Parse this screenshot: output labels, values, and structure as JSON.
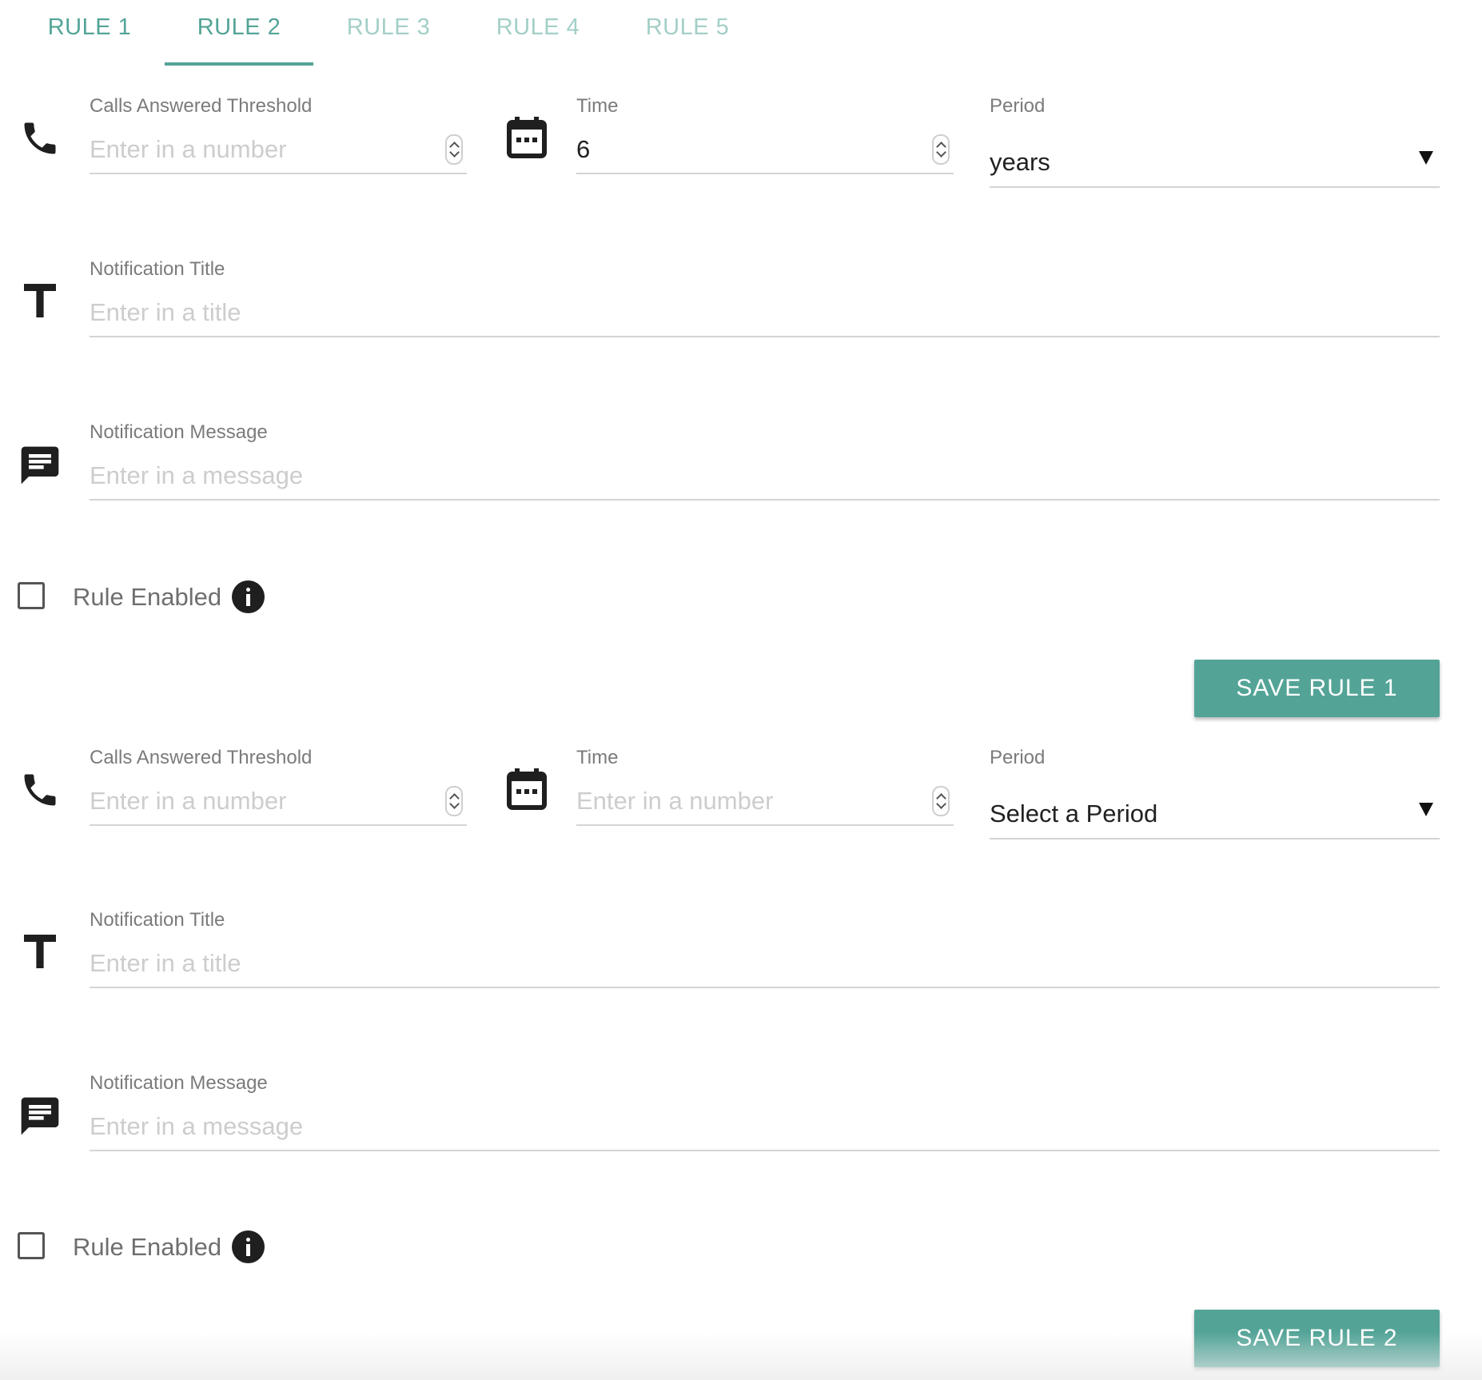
{
  "tabs": [
    {
      "label": "RULE 1"
    },
    {
      "label": "RULE 2"
    },
    {
      "label": "RULE 3"
    },
    {
      "label": "RULE 4"
    },
    {
      "label": "RULE 5"
    }
  ],
  "colors": {
    "accent": "#53a497",
    "accent_light": "#a3cfc7",
    "label": "#7b7b7b",
    "placeholder": "#cdcdcd"
  },
  "rules": [
    {
      "threshold": {
        "label": "Calls Answered Threshold",
        "placeholder": "Enter in a number",
        "value": "",
        "icon": "phone-icon"
      },
      "time": {
        "label": "Time",
        "placeholder": "Enter in a number",
        "value": "6",
        "icon": "calendar-icon"
      },
      "period": {
        "label": "Period",
        "value": "years"
      },
      "title": {
        "label": "Notification Title",
        "placeholder": "Enter in a title",
        "value": "",
        "icon": "text-title-icon"
      },
      "message": {
        "label": "Notification Message",
        "placeholder": "Enter in a message",
        "value": "",
        "icon": "message-icon"
      },
      "enabled": {
        "label": "Rule Enabled",
        "checked": false,
        "icon": "info-icon"
      },
      "save_label": "SAVE RULE 1"
    },
    {
      "threshold": {
        "label": "Calls Answered Threshold",
        "placeholder": "Enter in a number",
        "value": "",
        "icon": "phone-icon"
      },
      "time": {
        "label": "Time",
        "placeholder": "Enter in a number",
        "value": "",
        "icon": "calendar-icon"
      },
      "period": {
        "label": "Period",
        "value": "Select a Period"
      },
      "title": {
        "label": "Notification Title",
        "placeholder": "Enter in a title",
        "value": "",
        "icon": "text-title-icon"
      },
      "message": {
        "label": "Notification Message",
        "placeholder": "Enter in a message",
        "value": "",
        "icon": "message-icon"
      },
      "enabled": {
        "label": "Rule Enabled",
        "checked": false,
        "icon": "info-icon"
      },
      "save_label": "SAVE RULE 2"
    }
  ]
}
